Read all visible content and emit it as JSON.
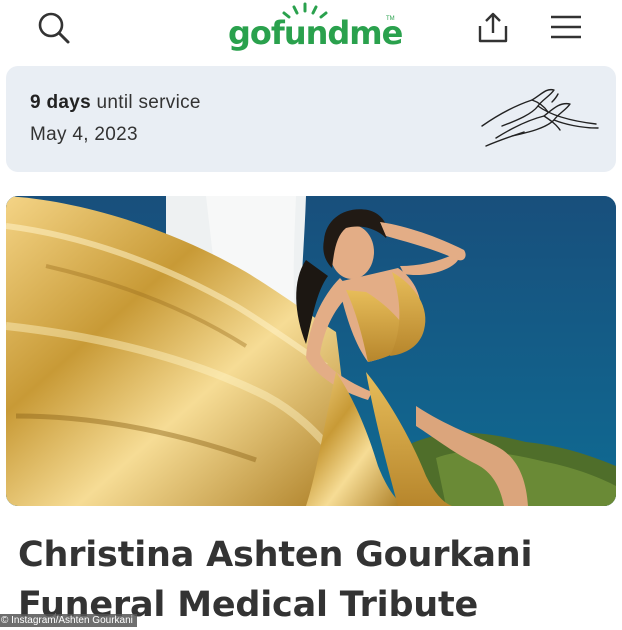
{
  "header": {
    "logo_text": "gofundme",
    "logo_tm": "TM",
    "brand_color": "#2aa14d",
    "icons": [
      "search-icon",
      "share-icon",
      "menu-icon"
    ]
  },
  "service": {
    "days_count": "9 days",
    "days_suffix": "until service",
    "date": "May 4, 2023",
    "icon": "calla-lily-icon",
    "background_color": "#e9eef4"
  },
  "hero": {
    "image": "woman-in-golden-gown-photo"
  },
  "campaign": {
    "title_line1": "Christina Ashten Gourkani",
    "title_line2": "Funeral Medical Tribute"
  },
  "credit": {
    "text": "© Instagram/Ashten Gourkani"
  }
}
